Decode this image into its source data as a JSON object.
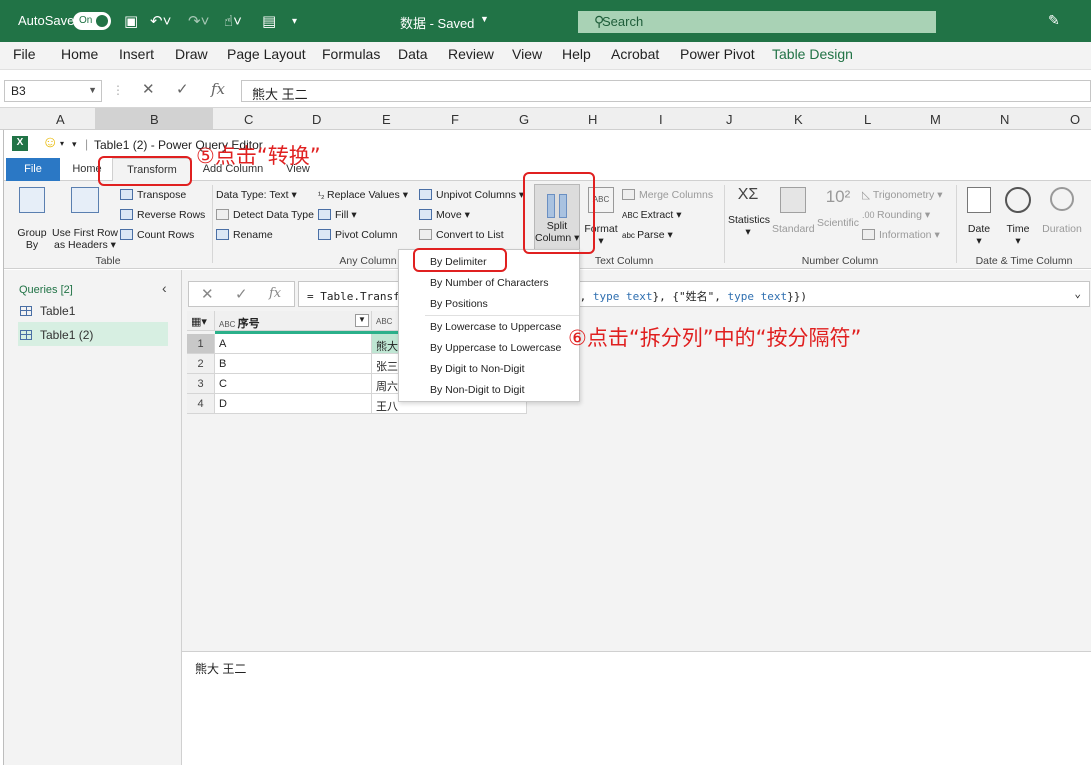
{
  "excel": {
    "autosave_label": "AutoSave",
    "autosave_state": "On",
    "doc_title": "数据 - Saved",
    "search_placeholder": "Search",
    "menu": [
      "File",
      "Home",
      "Insert",
      "Draw",
      "Page Layout",
      "Formulas",
      "Data",
      "Review",
      "View",
      "Help",
      "Acrobat",
      "Power Pivot",
      "Table Design"
    ],
    "name_box": "B3",
    "formula_value": "熊大 王二",
    "columns": [
      "A",
      "B",
      "C",
      "D",
      "E",
      "F",
      "G",
      "H",
      "I",
      "J",
      "K",
      "L",
      "M",
      "N",
      "O"
    ],
    "colors": {
      "title_bar": "#217346",
      "accent": "#217346"
    }
  },
  "pq": {
    "window_title": "Table1 (2) - Power Query Editor",
    "tabs": {
      "file": "File",
      "home": "Home",
      "transform": "Transform",
      "add_column": "Add Column",
      "view": "View"
    },
    "ribbon": {
      "table": {
        "group_by_1": "Group",
        "group_by_2": "By",
        "first_row_1": "Use First Row",
        "first_row_2": "as Headers",
        "transpose": "Transpose",
        "reverse_rows": "Reverse Rows",
        "count_rows": "Count Rows",
        "label": "Table"
      },
      "any_column": {
        "data_type": "Data Type: Text",
        "detect_type": "Detect Data Type",
        "rename": "Rename",
        "replace_values": "Replace Values",
        "fill": "Fill",
        "pivot": "Pivot Column",
        "unpivot": "Unpivot Columns",
        "move": "Move",
        "convert_list": "Convert to List",
        "label": "Any Column"
      },
      "text_column": {
        "split_1": "Split",
        "split_2": "Column",
        "format": "Format",
        "merge": "Merge Columns",
        "extract": "Extract",
        "parse": "Parse",
        "label": "Text Column"
      },
      "number_column": {
        "statistics": "Statistics",
        "standard": "Standard",
        "scientific": "Scientific",
        "trig": "Trigonometry",
        "rounding": "Rounding",
        "information": "Information",
        "label": "Number Column"
      },
      "datetime_column": {
        "date": "Date",
        "time": "Time",
        "duration": "Duration",
        "label": "Date & Time Column"
      }
    },
    "queries": {
      "header": "Queries [2]",
      "items": [
        "Table1",
        "Table1 (2)"
      ]
    },
    "formula": {
      "prefix": "= Table.Transfo",
      "suffix_a": "\", ",
      "type1": "type",
      "text1": "text",
      "mid": "}, {\"姓名\", ",
      "type2": "type",
      "text2": "text",
      "end": "}})"
    },
    "table": {
      "col1_header": "序号",
      "rows": [
        {
          "n": "1",
          "a": "A",
          "b": "熊大"
        },
        {
          "n": "2",
          "a": "B",
          "b": "张三"
        },
        {
          "n": "3",
          "a": "C",
          "b": "周六"
        },
        {
          "n": "4",
          "a": "D",
          "b": "王八"
        }
      ]
    },
    "split_menu": [
      "By Delimiter",
      "By Number of Characters",
      "By Positions",
      "By Lowercase to Uppercase",
      "By Uppercase to Lowercase",
      "By Digit to Non-Digit",
      "By Non-Digit to Digit"
    ],
    "preview_value": "熊大 王二"
  },
  "annotations": {
    "step5": "⑤点击“转换”",
    "step6": "⑥点击“拆分列”中的“按分隔符”",
    "color": "#e02020"
  }
}
